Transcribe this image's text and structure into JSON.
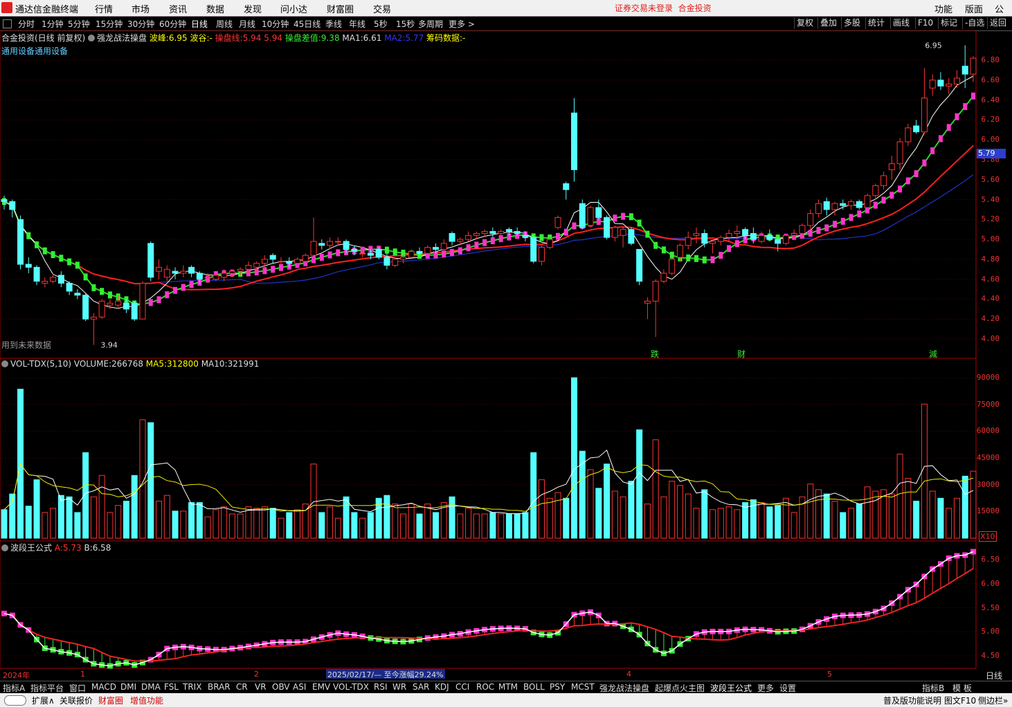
{
  "app": {
    "title": "通达信金融终端",
    "notice": "证券交易未登录",
    "stock_name": "合金投资"
  },
  "menu": [
    "行情",
    "市场",
    "资讯",
    "数据",
    "发现",
    "问小达",
    "财富圈",
    "交易"
  ],
  "right_menu": [
    "功能",
    "版面",
    "公式"
  ],
  "periods": [
    "分时",
    "1分钟",
    "5分钟",
    "15分钟",
    "30分钟",
    "60分钟",
    "日线",
    "周线",
    "月线",
    "10分钟",
    "45日线",
    "季线",
    "年线",
    "5秒",
    "15秒",
    "多周期",
    "更多 >"
  ],
  "active_period": "日线",
  "right_buttons": [
    "复权",
    "叠加",
    "多股",
    "统计",
    "画线",
    "F10",
    "标记",
    "-自选",
    "返回"
  ],
  "main_header": {
    "name": "合金投资(日线 前复权)",
    "indicator": "强龙战法操盘",
    "wave_peak_label": "波峰:",
    "wave_peak": "6.95",
    "wave_trough_label": "波谷:",
    "wave_trough": "-",
    "line_label": "操盘线:",
    "line_v1": "5.94",
    "line_v2": "5.94",
    "diff_label": "操盘差值:",
    "diff": "9.38",
    "ma1_label": "MA1:",
    "ma1": "6.61",
    "ma2_label": "MA2:",
    "ma2": "5.77",
    "chip_label": "筹码数据:",
    "chip": "-"
  },
  "sector": "通用设备通用设备",
  "future_note": "用到未来数据",
  "high_label": "6.95",
  "low_label": "3.94",
  "current_price_tag": "5.79",
  "price_axis": [
    "6.80",
    "6.60",
    "6.40",
    "6.20",
    "6.00",
    "5.80",
    "5.60",
    "5.40",
    "5.20",
    "5.00",
    "4.80",
    "4.60",
    "4.40",
    "4.20",
    "4.00"
  ],
  "markers": [
    {
      "text": "跌"
    },
    {
      "text": "财"
    },
    {
      "text": "減"
    }
  ],
  "vol_header": {
    "name": "VOL-TDX(5,10)",
    "volume_label": "VOLUME:",
    "volume": "266768",
    "ma5_label": "MA5:",
    "ma5": "312800",
    "ma10_label": "MA10:",
    "ma10": "321991"
  },
  "vol_axis": [
    "90000",
    "75000",
    "60000",
    "45000",
    "30000",
    "15000"
  ],
  "vol_unit": "X10",
  "wave_header": {
    "name": "波段王公式",
    "a_label": "A:",
    "a": "5.73",
    "b_label": "B:",
    "b": "6.58"
  },
  "wave_axis": [
    "6.50",
    "6.00",
    "5.50",
    "5.00",
    "4.50"
  ],
  "date_axis": {
    "year": "2024年",
    "months": [
      "1",
      "2",
      "4",
      "5"
    ],
    "range_tip": "2025/02/17/—  至今涨幅29.24%",
    "period": "日线"
  },
  "indicator_tabs": [
    "指标A",
    "指标平台",
    "窗口",
    "MACD",
    "DMI",
    "DMA",
    "FSL",
    "TRIX",
    "BRAR",
    "CR",
    "VR",
    "OBV",
    "ASI",
    "EMV",
    "VOL-TDX",
    "RSI",
    "WR",
    "SAR",
    "KDJ",
    "CCI",
    "ROC",
    "MTM",
    "BOLL",
    "PSY",
    "MCST",
    "强龙战法操盘",
    "起爆点火主图",
    "波段王公式",
    "更多",
    "设置"
  ],
  "indicator_tabs_right": [
    "指标B",
    "模 板"
  ],
  "status": {
    "expand": "扩展∧",
    "related": "关联报价",
    "fortune": "财富圈",
    "vas": "增值功能",
    "right1": "普及版功能说明",
    "right2": "图文F10",
    "right3": "侧边栏»"
  },
  "colors": {
    "up": "#ff3333",
    "down": "#55ffff",
    "bull_block": "#ff33cc",
    "bear_block": "#33ee33",
    "ma_red": "#ff2020",
    "ma_green": "#22dd22",
    "ma_blue": "#2233cc"
  },
  "chart_data": {
    "type": "candlestick",
    "candles": [
      {
        "o": 5.4,
        "h": 5.44,
        "l": 5.3,
        "c": 5.38
      },
      {
        "o": 5.38,
        "h": 5.4,
        "l": 5.22,
        "c": 5.3
      },
      {
        "o": 5.2,
        "h": 5.24,
        "l": 4.7,
        "c": 4.75
      },
      {
        "o": 4.75,
        "h": 4.82,
        "l": 4.66,
        "c": 4.72
      },
      {
        "o": 4.72,
        "h": 4.74,
        "l": 4.54,
        "c": 4.58
      },
      {
        "o": 4.56,
        "h": 4.62,
        "l": 4.52,
        "c": 4.58
      },
      {
        "o": 4.58,
        "h": 4.66,
        "l": 4.56,
        "c": 4.62
      },
      {
        "o": 4.64,
        "h": 4.68,
        "l": 4.52,
        "c": 4.56
      },
      {
        "o": 4.56,
        "h": 4.58,
        "l": 4.44,
        "c": 4.48
      },
      {
        "o": 4.46,
        "h": 4.5,
        "l": 4.4,
        "c": 4.44
      },
      {
        "o": 4.44,
        "h": 4.46,
        "l": 4.18,
        "c": 4.2
      },
      {
        "o": 4.2,
        "h": 4.26,
        "l": 3.94,
        "c": 4.22
      },
      {
        "o": 4.22,
        "h": 4.4,
        "l": 4.2,
        "c": 4.38
      },
      {
        "o": 4.34,
        "h": 4.4,
        "l": 4.3,
        "c": 4.36
      },
      {
        "o": 4.34,
        "h": 4.44,
        "l": 4.3,
        "c": 4.38
      },
      {
        "o": 4.36,
        "h": 4.4,
        "l": 4.26,
        "c": 4.3
      },
      {
        "o": 4.36,
        "h": 4.38,
        "l": 4.18,
        "c": 4.2
      },
      {
        "o": 4.2,
        "h": 4.58,
        "l": 4.2,
        "c": 4.56
      },
      {
        "o": 4.96,
        "h": 4.98,
        "l": 4.58,
        "c": 4.62
      },
      {
        "o": 4.68,
        "h": 4.8,
        "l": 4.6,
        "c": 4.72
      },
      {
        "o": 4.62,
        "h": 4.74,
        "l": 4.58,
        "c": 4.7
      },
      {
        "o": 4.68,
        "h": 4.72,
        "l": 4.6,
        "c": 4.66
      },
      {
        "o": 4.66,
        "h": 4.74,
        "l": 4.62,
        "c": 4.68
      },
      {
        "o": 4.72,
        "h": 4.74,
        "l": 4.62,
        "c": 4.66
      },
      {
        "o": 4.66,
        "h": 4.68,
        "l": 4.56,
        "c": 4.6
      },
      {
        "o": 4.62,
        "h": 4.66,
        "l": 4.56,
        "c": 4.62
      },
      {
        "o": 4.6,
        "h": 4.66,
        "l": 4.58,
        "c": 4.64
      },
      {
        "o": 4.62,
        "h": 4.7,
        "l": 4.58,
        "c": 4.66
      },
      {
        "o": 4.66,
        "h": 4.7,
        "l": 4.62,
        "c": 4.68
      },
      {
        "o": 4.68,
        "h": 4.72,
        "l": 4.64,
        "c": 4.7
      },
      {
        "o": 4.7,
        "h": 4.78,
        "l": 4.66,
        "c": 4.74
      },
      {
        "o": 4.72,
        "h": 4.78,
        "l": 4.68,
        "c": 4.76
      },
      {
        "o": 4.76,
        "h": 4.84,
        "l": 4.72,
        "c": 4.8
      },
      {
        "o": 4.84,
        "h": 4.86,
        "l": 4.76,
        "c": 4.8
      },
      {
        "o": 4.78,
        "h": 4.82,
        "l": 4.74,
        "c": 4.78
      },
      {
        "o": 4.78,
        "h": 4.82,
        "l": 4.72,
        "c": 4.76
      },
      {
        "o": 4.76,
        "h": 4.82,
        "l": 4.74,
        "c": 4.8
      },
      {
        "o": 4.78,
        "h": 4.86,
        "l": 4.76,
        "c": 4.84
      },
      {
        "o": 4.84,
        "h": 5.22,
        "l": 4.8,
        "c": 4.98
      },
      {
        "o": 4.96,
        "h": 5.0,
        "l": 4.9,
        "c": 4.94
      },
      {
        "o": 4.94,
        "h": 5.02,
        "l": 4.9,
        "c": 4.98
      },
      {
        "o": 4.98,
        "h": 5.02,
        "l": 4.94,
        "c": 4.98
      },
      {
        "o": 4.98,
        "h": 5.0,
        "l": 4.86,
        "c": 4.9
      },
      {
        "o": 4.9,
        "h": 4.94,
        "l": 4.84,
        "c": 4.88
      },
      {
        "o": 4.86,
        "h": 4.9,
        "l": 4.82,
        "c": 4.86
      },
      {
        "o": 4.86,
        "h": 4.9,
        "l": 4.8,
        "c": 4.84
      },
      {
        "o": 4.9,
        "h": 4.92,
        "l": 4.8,
        "c": 4.82
      },
      {
        "o": 4.82,
        "h": 4.86,
        "l": 4.7,
        "c": 4.74
      },
      {
        "o": 4.74,
        "h": 4.82,
        "l": 4.72,
        "c": 4.8
      },
      {
        "o": 4.8,
        "h": 4.84,
        "l": 4.76,
        "c": 4.82
      },
      {
        "o": 4.82,
        "h": 4.9,
        "l": 4.8,
        "c": 4.88
      },
      {
        "o": 4.88,
        "h": 4.92,
        "l": 4.84,
        "c": 4.86
      },
      {
        "o": 4.86,
        "h": 4.94,
        "l": 4.84,
        "c": 4.92
      },
      {
        "o": 4.92,
        "h": 4.96,
        "l": 4.86,
        "c": 4.9
      },
      {
        "o": 4.9,
        "h": 5.0,
        "l": 4.88,
        "c": 4.96
      },
      {
        "o": 5.06,
        "h": 5.08,
        "l": 4.94,
        "c": 4.98
      },
      {
        "o": 4.98,
        "h": 5.02,
        "l": 4.94,
        "c": 5.0
      },
      {
        "o": 5.0,
        "h": 5.08,
        "l": 4.98,
        "c": 5.04
      },
      {
        "o": 5.04,
        "h": 5.08,
        "l": 5.0,
        "c": 5.06
      },
      {
        "o": 5.06,
        "h": 5.1,
        "l": 5.02,
        "c": 5.08
      },
      {
        "o": 5.08,
        "h": 5.12,
        "l": 5.02,
        "c": 5.06
      },
      {
        "o": 5.06,
        "h": 5.1,
        "l": 5.02,
        "c": 5.08
      },
      {
        "o": 5.1,
        "h": 5.12,
        "l": 5.04,
        "c": 5.08
      },
      {
        "o": 5.08,
        "h": 5.12,
        "l": 5.04,
        "c": 5.06
      },
      {
        "o": 5.04,
        "h": 5.08,
        "l": 4.98,
        "c": 5.02
      },
      {
        "o": 5.02,
        "h": 5.04,
        "l": 4.76,
        "c": 4.78
      },
      {
        "o": 4.78,
        "h": 4.94,
        "l": 4.74,
        "c": 4.92
      },
      {
        "o": 4.92,
        "h": 5.02,
        "l": 4.9,
        "c": 5.0
      },
      {
        "o": 5.12,
        "h": 5.24,
        "l": 5.1,
        "c": 5.22
      },
      {
        "o": 5.56,
        "h": 5.58,
        "l": 5.4,
        "c": 5.5
      },
      {
        "o": 6.27,
        "h": 6.42,
        "l": 5.58,
        "c": 5.7
      },
      {
        "o": 5.36,
        "h": 5.4,
        "l": 5.1,
        "c": 5.12
      },
      {
        "o": 5.14,
        "h": 5.34,
        "l": 5.12,
        "c": 5.32
      },
      {
        "o": 5.32,
        "h": 5.4,
        "l": 5.2,
        "c": 5.22
      },
      {
        "o": 5.22,
        "h": 5.24,
        "l": 5.0,
        "c": 5.02
      },
      {
        "o": 5.02,
        "h": 5.14,
        "l": 4.98,
        "c": 5.12
      },
      {
        "o": 5.04,
        "h": 5.12,
        "l": 4.92,
        "c": 5.1
      },
      {
        "o": 5.1,
        "h": 5.12,
        "l": 4.94,
        "c": 4.96
      },
      {
        "o": 4.9,
        "h": 4.9,
        "l": 4.54,
        "c": 4.58
      },
      {
        "o": 4.36,
        "h": 4.42,
        "l": 4.2,
        "c": 4.38
      },
      {
        "o": 4.38,
        "h": 4.6,
        "l": 4.02,
        "c": 4.58
      },
      {
        "o": 4.58,
        "h": 4.7,
        "l": 4.56,
        "c": 4.66
      },
      {
        "o": 4.66,
        "h": 4.82,
        "l": 4.64,
        "c": 4.8
      },
      {
        "o": 4.82,
        "h": 4.96,
        "l": 4.78,
        "c": 4.94
      },
      {
        "o": 4.94,
        "h": 5.08,
        "l": 4.9,
        "c": 5.02
      },
      {
        "o": 5.04,
        "h": 5.12,
        "l": 4.96,
        "c": 5.06
      },
      {
        "o": 5.06,
        "h": 5.1,
        "l": 4.92,
        "c": 4.96
      },
      {
        "o": 4.96,
        "h": 5.0,
        "l": 4.86,
        "c": 4.98
      },
      {
        "o": 4.98,
        "h": 5.04,
        "l": 4.94,
        "c": 5.02
      },
      {
        "o": 5.02,
        "h": 5.1,
        "l": 4.98,
        "c": 5.06
      },
      {
        "o": 5.06,
        "h": 5.14,
        "l": 5.0,
        "c": 5.08
      },
      {
        "o": 5.1,
        "h": 5.12,
        "l": 5.0,
        "c": 5.04
      },
      {
        "o": 5.06,
        "h": 5.12,
        "l": 4.96,
        "c": 5.0
      },
      {
        "o": 4.98,
        "h": 5.08,
        "l": 4.96,
        "c": 5.04
      },
      {
        "o": 5.04,
        "h": 5.1,
        "l": 4.98,
        "c": 5.0
      },
      {
        "o": 5.0,
        "h": 5.02,
        "l": 4.88,
        "c": 4.96
      },
      {
        "o": 4.96,
        "h": 5.06,
        "l": 4.94,
        "c": 5.04
      },
      {
        "o": 5.04,
        "h": 5.1,
        "l": 5.0,
        "c": 5.06
      },
      {
        "o": 5.06,
        "h": 5.16,
        "l": 5.02,
        "c": 5.14
      },
      {
        "o": 5.14,
        "h": 5.3,
        "l": 5.1,
        "c": 5.26
      },
      {
        "o": 5.26,
        "h": 5.4,
        "l": 5.22,
        "c": 5.36
      },
      {
        "o": 5.38,
        "h": 5.42,
        "l": 5.24,
        "c": 5.3
      },
      {
        "o": 5.3,
        "h": 5.38,
        "l": 5.24,
        "c": 5.36
      },
      {
        "o": 5.36,
        "h": 5.4,
        "l": 5.3,
        "c": 5.34
      },
      {
        "o": 5.34,
        "h": 5.4,
        "l": 5.3,
        "c": 5.38
      },
      {
        "o": 5.38,
        "h": 5.4,
        "l": 5.3,
        "c": 5.32
      },
      {
        "o": 5.32,
        "h": 5.46,
        "l": 5.3,
        "c": 5.44
      },
      {
        "o": 5.44,
        "h": 5.56,
        "l": 5.4,
        "c": 5.54
      },
      {
        "o": 5.54,
        "h": 5.68,
        "l": 5.5,
        "c": 5.64
      },
      {
        "o": 5.7,
        "h": 5.84,
        "l": 5.6,
        "c": 5.76
      },
      {
        "o": 5.76,
        "h": 6.02,
        "l": 5.7,
        "c": 5.98
      },
      {
        "o": 5.98,
        "h": 6.16,
        "l": 5.94,
        "c": 6.12
      },
      {
        "o": 6.14,
        "h": 6.2,
        "l": 6.06,
        "c": 6.08
      },
      {
        "o": 6.08,
        "h": 6.72,
        "l": 6.06,
        "c": 6.42
      },
      {
        "o": 6.52,
        "h": 6.66,
        "l": 6.44,
        "c": 6.6
      },
      {
        "o": 6.6,
        "h": 6.68,
        "l": 6.5,
        "c": 6.54
      },
      {
        "o": 6.54,
        "h": 6.62,
        "l": 6.46,
        "c": 6.56
      },
      {
        "o": 6.56,
        "h": 6.7,
        "l": 6.52,
        "c": 6.62
      },
      {
        "o": 6.74,
        "h": 6.95,
        "l": 6.52,
        "c": 6.66
      },
      {
        "o": 6.66,
        "h": 6.84,
        "l": 6.58,
        "c": 6.82
      }
    ],
    "volume_up_color": "#ff3333",
    "volume_down_color": "#55ffff"
  }
}
